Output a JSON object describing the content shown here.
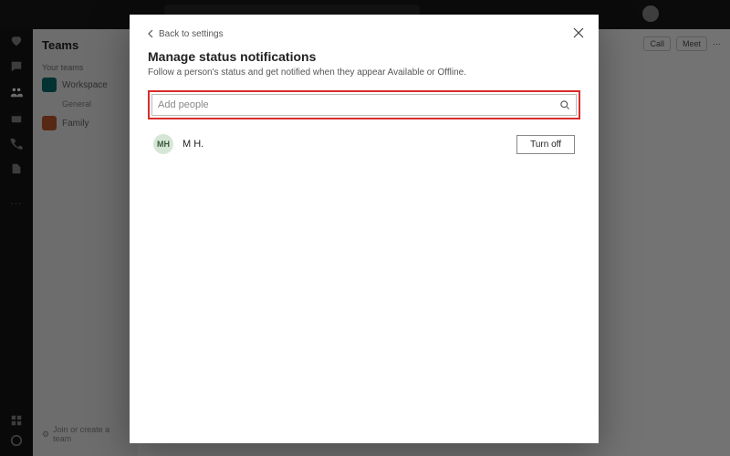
{
  "sidebar_icons": [
    "activity",
    "chat",
    "teams",
    "calendar",
    "call",
    "files"
  ],
  "panel": {
    "header": "Teams",
    "section_label": "Your teams",
    "teams": [
      {
        "name": "Workspace",
        "color": "teal",
        "channel": "General"
      },
      {
        "name": "Family",
        "color": "orn"
      }
    ],
    "join_link": "Join or create a team"
  },
  "toolbar": {
    "call": "Call",
    "meet": "Meet"
  },
  "modal": {
    "back_label": "Back to settings",
    "title": "Manage status notifications",
    "subtitle": "Follow a person's status and get notified when they appear Available or Offline.",
    "search_placeholder": "Add people",
    "person": {
      "initials": "MH",
      "name": "M H."
    },
    "turn_off_label": "Turn off"
  }
}
